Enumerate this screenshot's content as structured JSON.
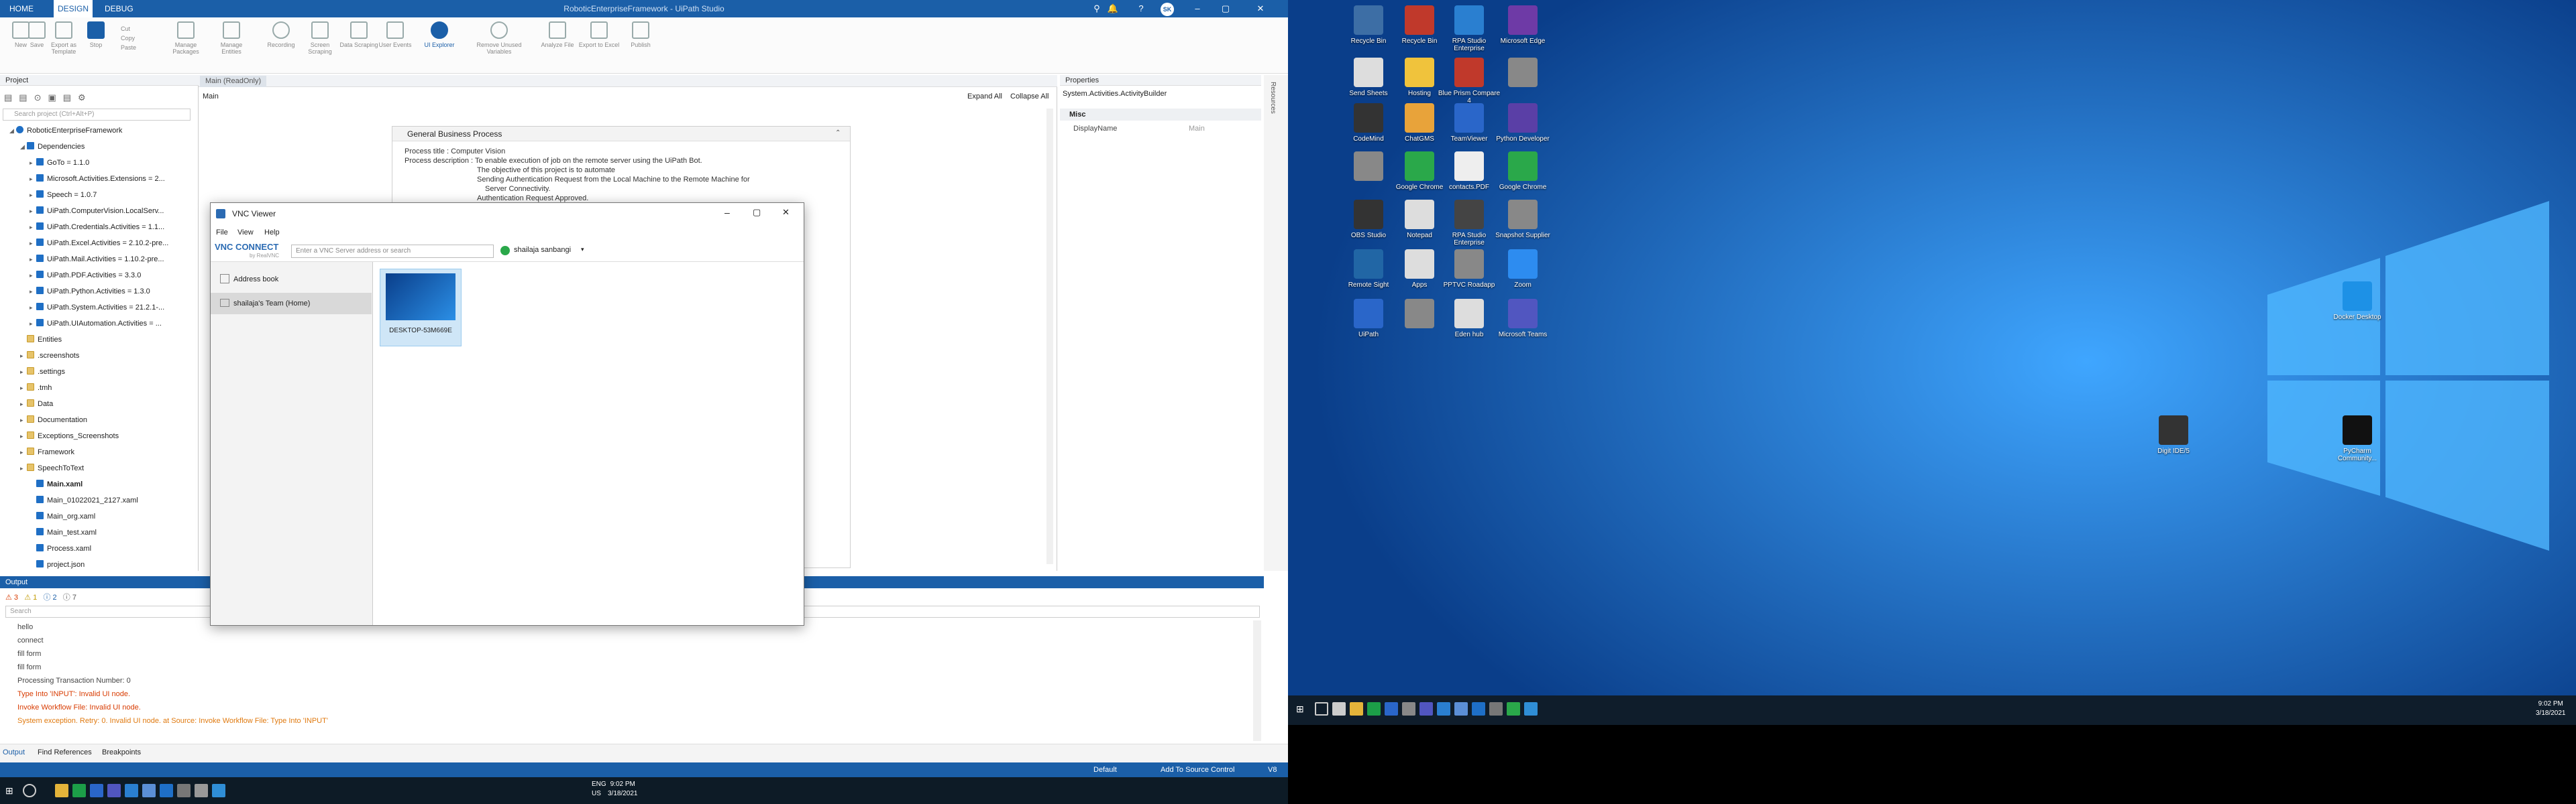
{
  "studio": {
    "title": "RoboticEnterpriseFramework - UiPath Studio",
    "tabs": [
      "HOME",
      "DESIGN",
      "DEBUG"
    ],
    "ribbon": [
      "New",
      "Save",
      "Export as Template",
      "Stop",
      "Cut",
      "Copy",
      "Paste",
      "Manage Packages",
      "Manage Entities",
      "Recording",
      "Screen Scraping",
      "Data Scraping",
      "User Events",
      "UI Explorer",
      "Remove Unused Variables",
      "Analyze File",
      "Export to Excel",
      "Publish"
    ],
    "avatar": "SK",
    "project": {
      "title": "Project",
      "search_placeholder": "Search project (Ctrl+Alt+P)",
      "root": "RoboticEnterpriseFramework",
      "deps_label": "Dependencies",
      "items": [
        "GoTo = 1.1.0",
        "Microsoft.Activities.Extensions = 2...",
        "Speech = 1.0.7",
        "UiPath.ComputerVision.LocalServ...",
        "UiPath.Credentials.Activities = 1.1...",
        "UiPath.Excel.Activities = 2.10.2-pre...",
        "UiPath.Mail.Activities = 1.10.2-pre...",
        "UiPath.PDF.Activities = 3.3.0",
        "UiPath.Python.Activities = 1.3.0",
        "UiPath.System.Activities = 21.2.1-...",
        "UiPath.UIAutomation.Activities = ...",
        "Entities",
        ".screenshots",
        ".settings",
        ".tmh",
        "Data",
        "Documentation",
        "Exceptions_Screenshots",
        "Framework",
        "SpeechToText",
        "Main.xaml",
        "Main_01022021_2127.xaml",
        "Main_org.xaml",
        "Main_test.xaml",
        "Process.xaml",
        "project.json"
      ]
    },
    "designer": {
      "tab": "Main (ReadOnly)",
      "breadcrumb": "Main",
      "expand": "Expand All",
      "collapse": "Collapse All",
      "box_title": "General Business Process",
      "lines": [
        "Process title : Computer Vision",
        "Process description : To enable execution of job on the remote server using the UiPath  Bot.",
        "The objective of this project is to automate",
        "Sending Authentication Request from the Local  Machine to the Remote Machine for",
        "Server Connectivity.",
        "Authentication Request Approved."
      ]
    },
    "properties": {
      "title": "Properties",
      "type": "System.Activities.ActivityBuilder",
      "section": "Misc",
      "prop": "DisplayName",
      "value": "Main"
    },
    "side_tab": "Resources",
    "output": {
      "title": "Output",
      "counts": [
        "3",
        "1",
        "2",
        "7"
      ],
      "search": "Search",
      "lines": [
        {
          "t": "hello",
          "c": "#444"
        },
        {
          "t": "connect",
          "c": "#444"
        },
        {
          "t": "fill form",
          "c": "#444"
        },
        {
          "t": "fill form",
          "c": "#444"
        },
        {
          "t": "Processing Transaction Number: 0",
          "c": "#444"
        },
        {
          "t": "Type Into 'INPUT': Invalid UI node.",
          "c": "#d83b01"
        },
        {
          "t": "Invoke Workflow File: Invalid UI node.",
          "c": "#d83b01"
        },
        {
          "t": "System exception. Retry: 0. Invalid UI node. at Source: Invoke Workflow File: Type Into 'INPUT'",
          "c": "#e07a10"
        }
      ]
    },
    "bottom_tabs": [
      "Output",
      "Find References",
      "Breakpoints"
    ],
    "status": {
      "profile": "Default",
      "source": "Add To Source Control",
      "version": "V8"
    }
  },
  "vnc": {
    "title": "VNC Viewer",
    "menu": [
      "File",
      "View",
      "Help"
    ],
    "logo": "VNC CONNECT",
    "logo_sub": "by RealVNC",
    "search_placeholder": "Enter a VNC Server address or search",
    "user": "shailaja sanbangi",
    "side": [
      "Address book",
      "shailaja's Team (Home)"
    ],
    "computer": "DESKTOP-53M669E"
  },
  "taskbar": {
    "lang": "ENG",
    "region": "US",
    "time": "9:02 PM",
    "date": "3/18/2021"
  },
  "desktop": {
    "icons": [
      "Recycle Bin",
      "Recycle Bin",
      "RPA Studio Enterprise",
      "Microsoft Edge",
      "Send Sheets",
      "Hosting",
      "Blue Prism Compare 4",
      "",
      "CodeMind",
      "ChatGMS",
      "TeamViewer",
      "Python Developer",
      "",
      "Google Chrome",
      "contacts.PDF",
      "Google Chrome",
      "OBS Studio",
      "Notepad",
      "RPA Studio Enterprise",
      "Snapshot Supplier",
      "Remote Sight",
      "Apps",
      "PPTVC Roadapp",
      "Zoom",
      "UiPath",
      "",
      "Eden hub",
      "Microsoft Teams"
    ],
    "right_icons": [
      "Docker Desktop",
      "PyCharm Community...",
      "Digit IDE/5"
    ],
    "taskbar_time": "9:02 PM",
    "taskbar_date": "3/18/2021"
  }
}
